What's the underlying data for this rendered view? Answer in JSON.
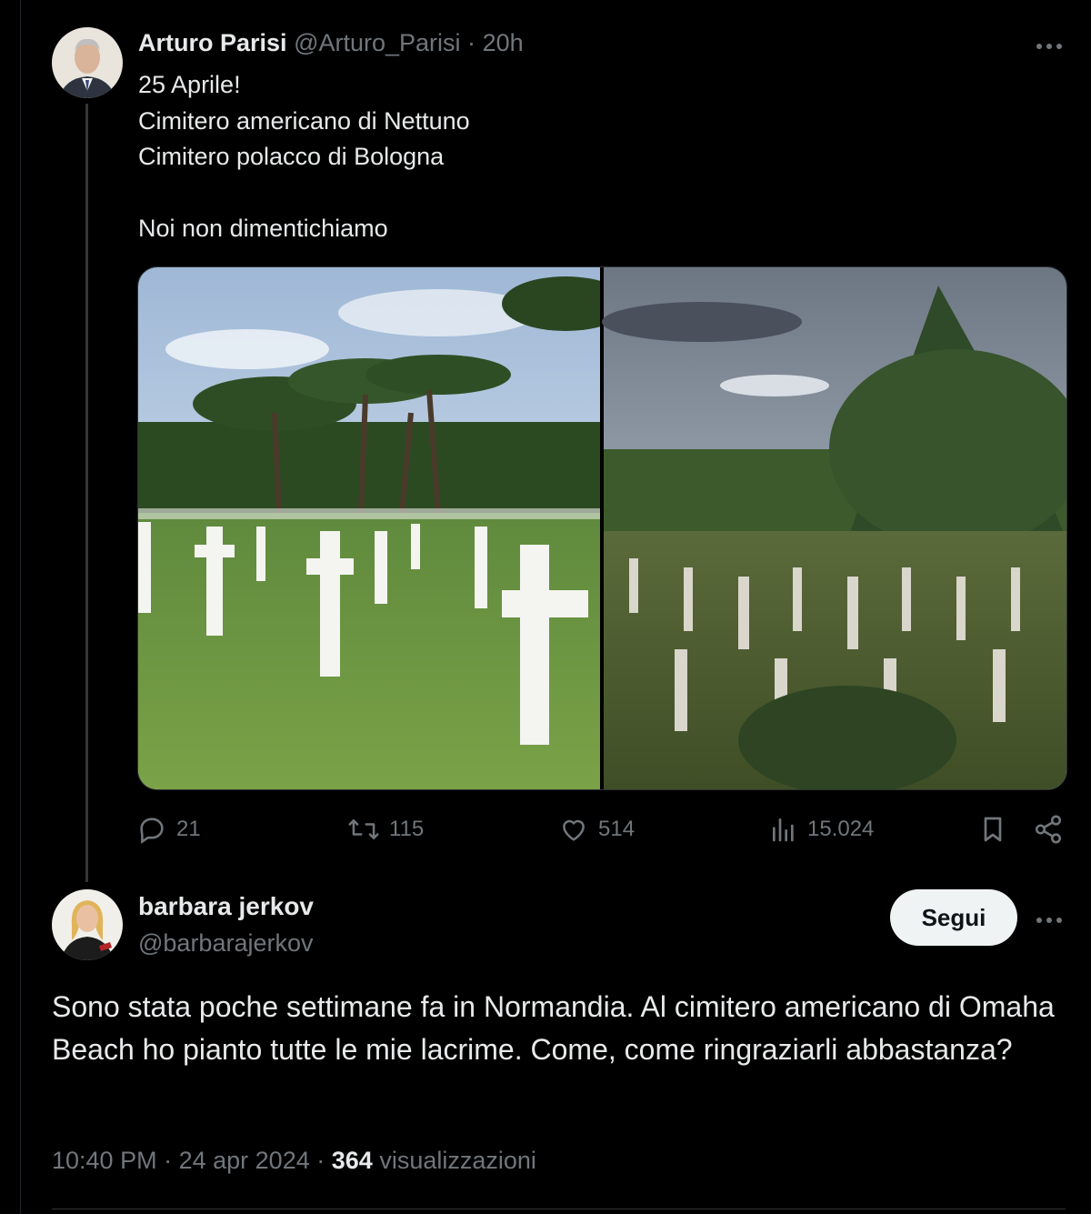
{
  "tweet1": {
    "author_name": "Arturo Parisi",
    "author_handle": "@Arturo_Parisi",
    "separator": "·",
    "time_ago": "20h",
    "text_lines": [
      "25 Aprile!",
      "Cimitero americano di Nettuno",
      "Cimitero polacco di Bologna",
      "",
      "Noi non dimentichiamo"
    ],
    "media": [
      {
        "description_icon": "cemetery-photo-nettuno"
      },
      {
        "description_icon": "cemetery-photo-bologna"
      }
    ],
    "stats": {
      "replies": "21",
      "reposts": "115",
      "likes": "514",
      "views": "15.024"
    }
  },
  "tweet2": {
    "author_name": "barbara jerkov",
    "author_handle": "@barbarajerkov",
    "follow_label": "Segui",
    "text": "Sono stata poche settimane fa in Normandia. Al cimitero americano di Omaha Beach ho pianto tutte le mie lacrime. Come, come ringraziarli abbastanza?",
    "time": "10:40 PM",
    "dot": "·",
    "date": "24 apr 2024",
    "views_count": "364",
    "views_label": "visualizzazioni"
  },
  "colors": {
    "background": "#000000",
    "text": "#e7e9ea",
    "muted": "#71767b",
    "border": "#2f3336",
    "follow_bg": "#eff3f4"
  }
}
